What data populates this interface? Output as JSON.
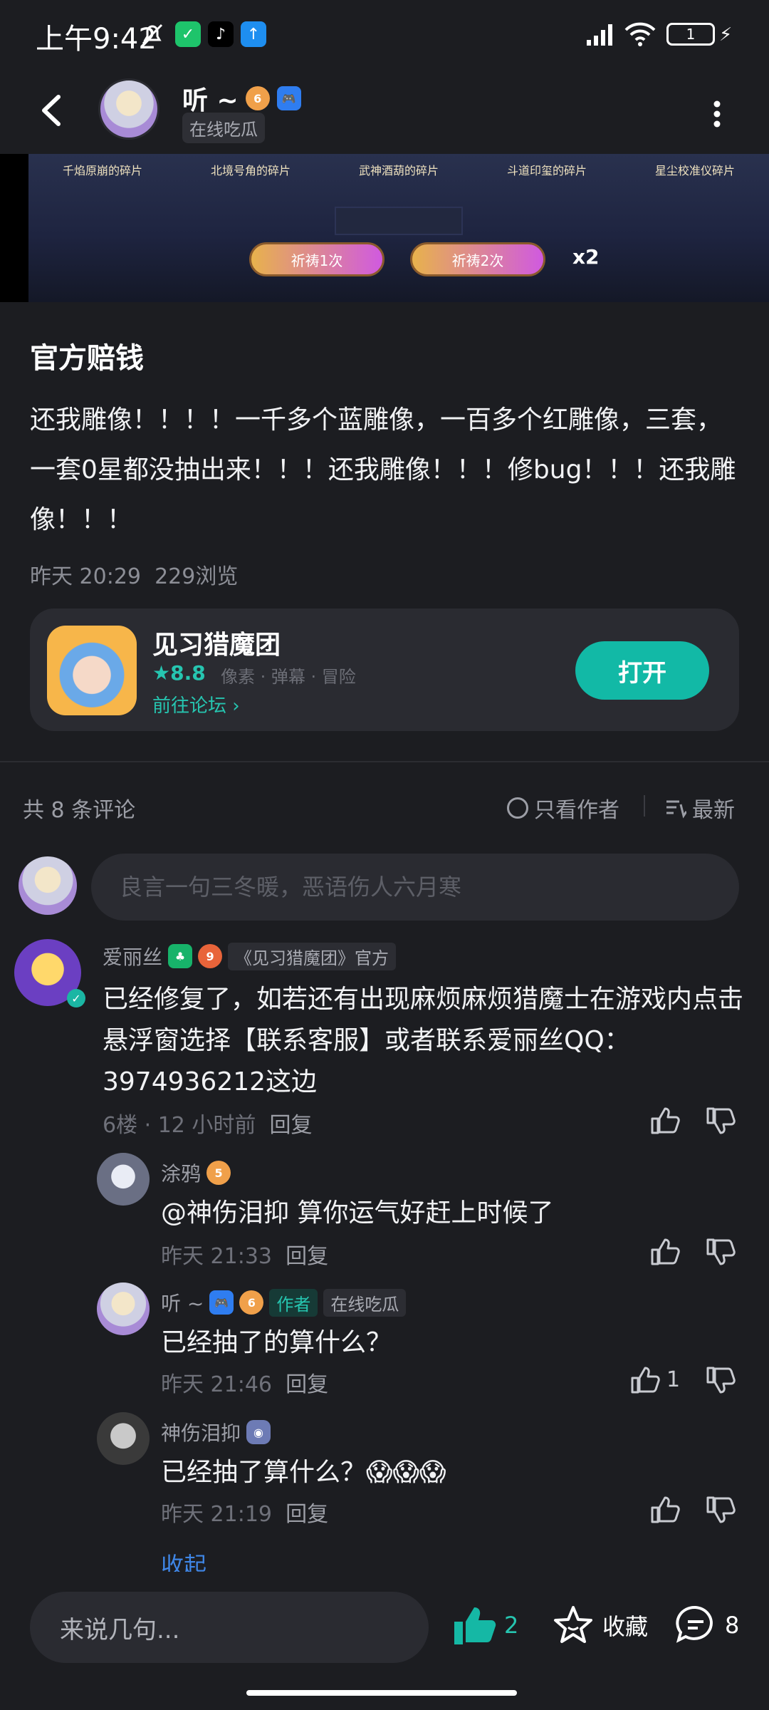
{
  "status_bar": {
    "time": "上午9:42",
    "battery": "1"
  },
  "header": {
    "name": "听 ~",
    "subtitle": "在线吃瓜",
    "level_badge": "6"
  },
  "banner": {
    "fragments": [
      "千焰原崩的碎片",
      "北境号角的碎片",
      "武神酒葫的碎片",
      "斗道印玺的碎片",
      "星尘校准仪碎片"
    ],
    "pray_buttons": [
      "祈祷1次",
      "祈祷2次"
    ],
    "multiplier": "x2"
  },
  "post": {
    "title": "官方赔钱",
    "body": "还我雕像！！！！一千多个蓝雕像，一百多个红雕像，三套，一套0星都没抽出来！！！还我雕像！！！修bug！！！还我雕像！！！",
    "time": "昨天 20:29",
    "views": "229浏览"
  },
  "game_card": {
    "name": "见习猎魔团",
    "rating": "8.8",
    "tags": "像素 · 弹幕 · 冒险",
    "forum_link": "前往论坛",
    "open_button": "打开"
  },
  "comments_header": {
    "count": "共 8 条评论",
    "only_author": "只看作者",
    "sort": "最新"
  },
  "comment_input": {
    "placeholder": "良言一句三冬暖，恶语伤人六月寒"
  },
  "comments": [
    {
      "name": "爱丽丝",
      "level": "9",
      "official_tag": "《见习猎魔团》官方",
      "text": "已经修复了，如若还有出现麻烦麻烦猎魔士在游戏内点击悬浮窗选择【联系客服】或者联系爱丽丝QQ：3974936212这边",
      "meta": "6楼 · 12 小时前",
      "reply": "回复"
    }
  ],
  "replies": [
    {
      "name": "涂鸦",
      "level": "5",
      "text": "@神伤泪抑  算你运气好赶上时候了",
      "time": "昨天 21:33",
      "reply": "回复",
      "likes": ""
    },
    {
      "name": "听 ~",
      "level": "6",
      "author_tag": "作者",
      "status_tag": "在线吃瓜",
      "text": "已经抽了的算什么？",
      "time": "昨天 21:46",
      "reply": "回复",
      "likes": "1"
    },
    {
      "name": "神伤泪抑",
      "text": "已经抽了算什么？😱😱😱",
      "time": "昨天 21:19",
      "reply": "回复",
      "likes": ""
    }
  ],
  "collapse": "收起",
  "bottom_bar": {
    "input_placeholder": "来说几句...",
    "likes": "2",
    "favorite": "收藏",
    "comments": "8"
  },
  "colors": {
    "background": "#1c1d21",
    "accent": "#12b9a6",
    "link": "#3f86e6"
  }
}
